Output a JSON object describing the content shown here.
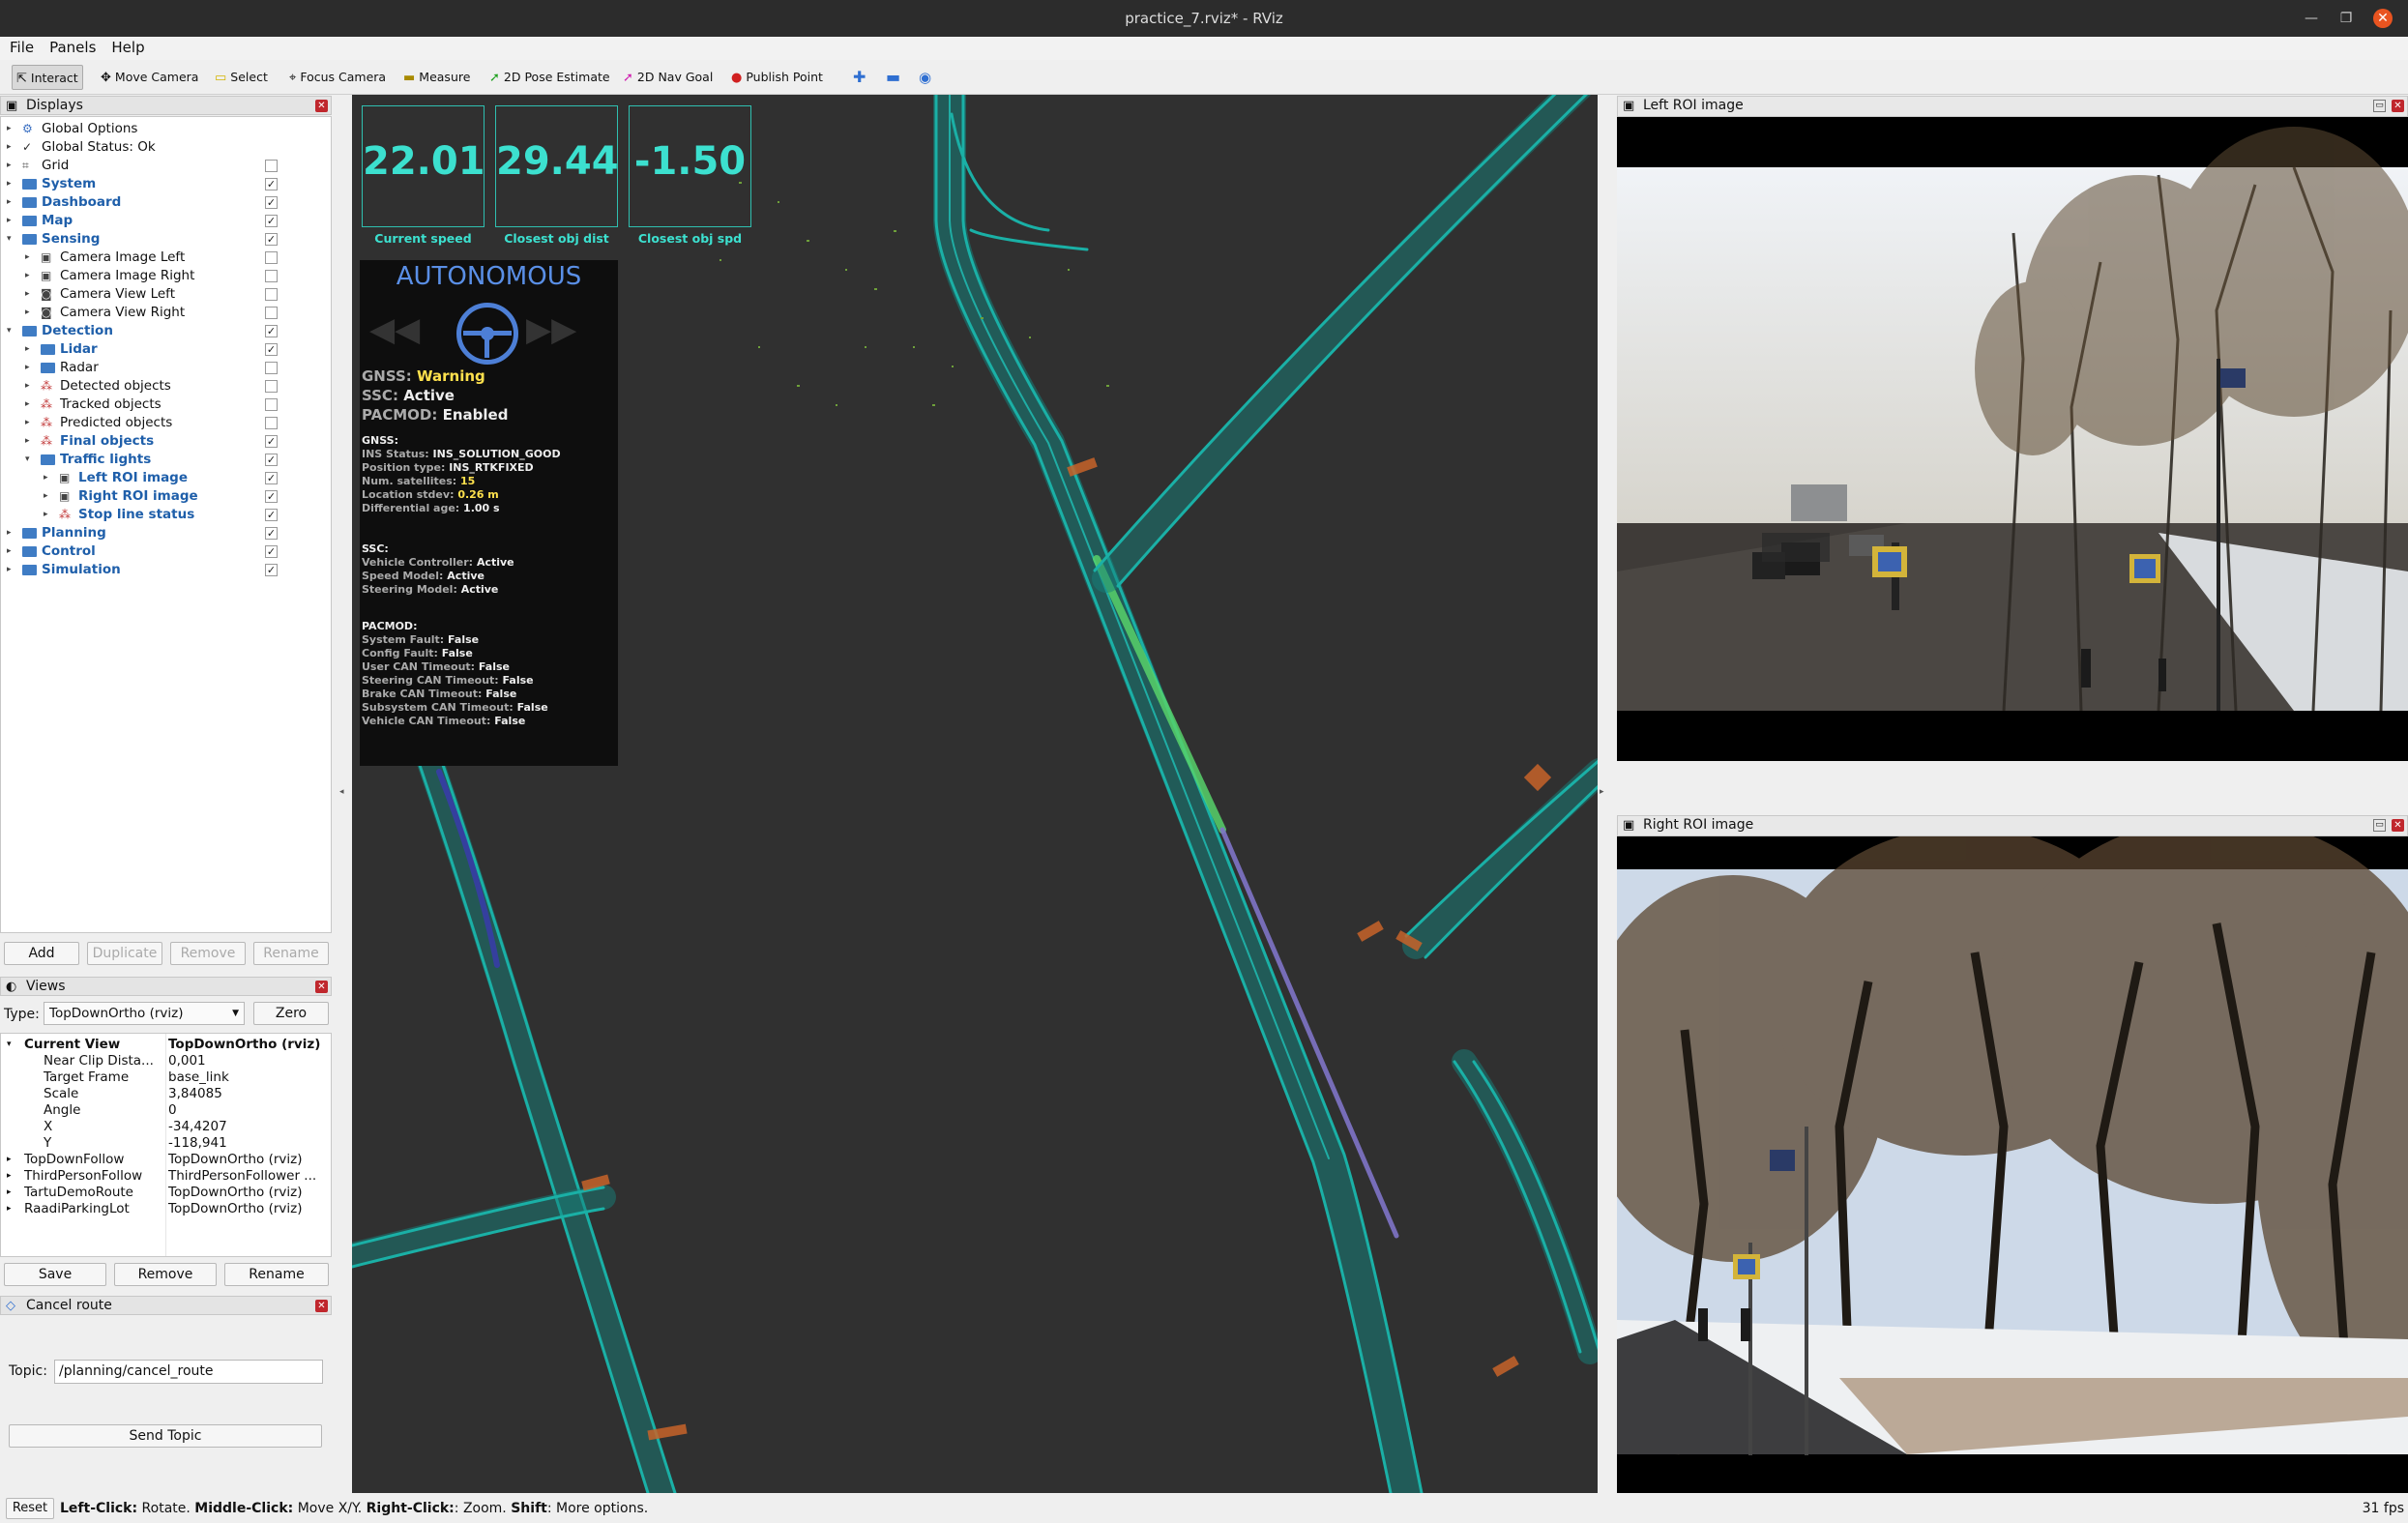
{
  "window": {
    "title": "practice_7.rviz* - RViz"
  },
  "menu": [
    "File",
    "Panels",
    "Help"
  ],
  "toolbar": {
    "interact": "Interact",
    "move_camera": "Move Camera",
    "select": "Select",
    "focus_camera": "Focus Camera",
    "measure": "Measure",
    "pose_estimate": "2D Pose Estimate",
    "nav_goal": "2D Nav Goal",
    "publish_point": "Publish Point"
  },
  "displays": {
    "title": "Displays",
    "items": [
      {
        "label": "Global Options",
        "level": 0,
        "icon": "gear-icon",
        "blue": false,
        "check": null
      },
      {
        "label": "Global Status: Ok",
        "level": 0,
        "icon": "checkmark-icon",
        "blue": false,
        "check": null
      },
      {
        "label": "Grid",
        "level": 0,
        "icon": "grid-icon",
        "blue": false,
        "check": false
      },
      {
        "label": "System",
        "level": 0,
        "icon": "folder-icon",
        "blue": true,
        "check": true
      },
      {
        "label": "Dashboard",
        "level": 0,
        "icon": "folder-icon",
        "blue": true,
        "check": true
      },
      {
        "label": "Map",
        "level": 0,
        "icon": "folder-icon",
        "blue": true,
        "check": true
      },
      {
        "label": "Sensing",
        "level": 0,
        "icon": "folder-icon",
        "blue": true,
        "check": true
      },
      {
        "label": "Camera Image Left",
        "level": 1,
        "icon": "image-icon",
        "blue": false,
        "check": false
      },
      {
        "label": "Camera Image Right",
        "level": 1,
        "icon": "image-icon",
        "blue": false,
        "check": false
      },
      {
        "label": "Camera View Left",
        "level": 1,
        "icon": "camera-icon",
        "blue": false,
        "check": false
      },
      {
        "label": "Camera View Right",
        "level": 1,
        "icon": "camera-icon",
        "blue": false,
        "check": false
      },
      {
        "label": "Detection",
        "level": 0,
        "icon": "folder-icon",
        "blue": true,
        "check": true
      },
      {
        "label": "Lidar",
        "level": 1,
        "icon": "folder-icon",
        "blue": true,
        "check": true
      },
      {
        "label": "Radar",
        "level": 1,
        "icon": "folder-icon",
        "blue": false,
        "check": false
      },
      {
        "label": "Detected objects",
        "level": 1,
        "icon": "marker-icon",
        "blue": false,
        "check": false
      },
      {
        "label": "Tracked objects",
        "level": 1,
        "icon": "marker-icon",
        "blue": false,
        "check": false
      },
      {
        "label": "Predicted objects",
        "level": 1,
        "icon": "marker-icon",
        "blue": false,
        "check": false
      },
      {
        "label": "Final objects",
        "level": 1,
        "icon": "marker-icon",
        "blue": true,
        "check": true
      },
      {
        "label": "Traffic lights",
        "level": 1,
        "icon": "folder-icon",
        "blue": true,
        "check": true
      },
      {
        "label": "Left ROI image",
        "level": 2,
        "icon": "image-icon",
        "blue": true,
        "check": true
      },
      {
        "label": "Right ROI image",
        "level": 2,
        "icon": "image-icon",
        "blue": true,
        "check": true
      },
      {
        "label": "Stop line status",
        "level": 2,
        "icon": "marker-icon",
        "blue": true,
        "check": true
      },
      {
        "label": "Planning",
        "level": 0,
        "icon": "folder-icon",
        "blue": true,
        "check": true
      },
      {
        "label": "Control",
        "level": 0,
        "icon": "folder-icon",
        "blue": true,
        "check": true
      },
      {
        "label": "Simulation",
        "level": 0,
        "icon": "folder-icon",
        "blue": true,
        "check": true
      }
    ],
    "buttons": {
      "add": "Add",
      "duplicate": "Duplicate",
      "remove": "Remove",
      "rename": "Rename"
    }
  },
  "views": {
    "title": "Views",
    "type_label": "Type:",
    "type_value": "TopDownOrtho (rviz)",
    "zero": "Zero",
    "rows": [
      {
        "k": "Current View",
        "v": "TopDownOrtho (rviz)",
        "bold": true,
        "arrow": "▾",
        "indent": 1
      },
      {
        "k": "Near Clip Dista...",
        "v": "0,001",
        "bold": false,
        "arrow": "",
        "indent": 2
      },
      {
        "k": "Target Frame",
        "v": "base_link",
        "bold": false,
        "arrow": "",
        "indent": 2
      },
      {
        "k": "Scale",
        "v": "3,84085",
        "bold": false,
        "arrow": "",
        "indent": 2
      },
      {
        "k": "Angle",
        "v": "0",
        "bold": false,
        "arrow": "",
        "indent": 2
      },
      {
        "k": "X",
        "v": "-34,4207",
        "bold": false,
        "arrow": "",
        "indent": 2
      },
      {
        "k": "Y",
        "v": "-118,941",
        "bold": false,
        "arrow": "",
        "indent": 2
      },
      {
        "k": "TopDownFollow",
        "v": "TopDownOrtho (rviz)",
        "bold": false,
        "arrow": "▸",
        "indent": 1
      },
      {
        "k": "ThirdPersonFollow",
        "v": "ThirdPersonFollower ...",
        "bold": false,
        "arrow": "▸",
        "indent": 1
      },
      {
        "k": "TartuDemoRoute",
        "v": "TopDownOrtho (rviz)",
        "bold": false,
        "arrow": "▸",
        "indent": 1
      },
      {
        "k": "RaadiParkingLot",
        "v": "TopDownOrtho (rviz)",
        "bold": false,
        "arrow": "▸",
        "indent": 1
      }
    ],
    "buttons": {
      "save": "Save",
      "remove": "Remove",
      "rename": "Rename"
    }
  },
  "cancel_route": {
    "title": "Cancel route",
    "topic_label": "Topic:",
    "topic_value": "/planning/cancel_route",
    "send": "Send Topic"
  },
  "hud": {
    "current_speed": {
      "value": "22.01",
      "label": "Current speed"
    },
    "closest_obj_dist": {
      "value": "29.44",
      "label": "Closest obj dist"
    },
    "closest_obj_spd": {
      "value": "-1.50",
      "label": "Closest obj spd"
    }
  },
  "autonomy": {
    "mode": "AUTONOMOUS",
    "gnss_label": "GNSS:",
    "gnss_value": "Warning",
    "ssc_label": "SSC:",
    "ssc_value": "Active",
    "pacmod_label": "PACMOD:",
    "pacmod_value": "Enabled",
    "gnss_section": "GNSS:",
    "ins_status_k": "INS Status:",
    "ins_status_v": "INS_SOLUTION_GOOD",
    "pos_type_k": "Position type:",
    "pos_type_v": "INS_RTKFIXED",
    "sats_k": "Num. satellites:",
    "sats_v": "15",
    "loc_k": "Location stdev:",
    "loc_v": "0.26 m",
    "diff_k": "Differential age:",
    "diff_v": "1.00 s",
    "ssc_section": "SSC:",
    "vc_k": "Vehicle Controller:",
    "vc_v": "Active",
    "sm_k": "Speed Model:",
    "sm_v": "Active",
    "stm_k": "Steering Model:",
    "stm_v": "Active",
    "pacmod_section": "PACMOD:",
    "sf_k": "System Fault:",
    "sf_v": "False",
    "cf_k": "Config Fault:",
    "cf_v": "False",
    "uc_k": "User CAN Timeout:",
    "uc_v": "False",
    "sc_k": "Steering CAN Timeout:",
    "sc_v": "False",
    "bc_k": "Brake CAN Timeout:",
    "bc_v": "False",
    "ssc_k": "Subsystem CAN Timeout:",
    "ssc_v": "False",
    "vcan_k": "Vehicle CAN Timeout:",
    "vcan_v": "False"
  },
  "left_roi": {
    "title": "Left ROI image"
  },
  "right_roi": {
    "title": "Right ROI image"
  },
  "status": {
    "reset": "Reset",
    "b1": "Left-Click:",
    "t1": " Rotate. ",
    "b2": "Middle-Click:",
    "t2": " Move X/Y. ",
    "b3": "Right-Click:",
    "t3": ": Zoom. ",
    "b4": "Shift",
    "t4": ": More options.",
    "fps": "31 fps"
  },
  "colors": {
    "lane": "#1aa39a",
    "hud": "#3ce0cf",
    "accent": "#e95420",
    "warning": "#ffe14d",
    "folder": "#3f7cc4"
  }
}
